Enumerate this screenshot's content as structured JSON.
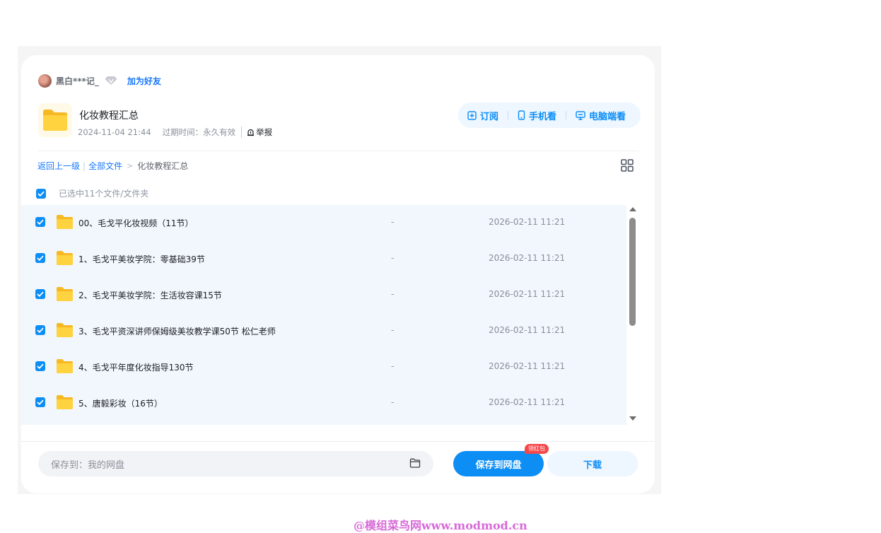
{
  "owner": {
    "username": "黑白***记_",
    "add_friend_label": "加为好友"
  },
  "share": {
    "title": "化妆教程汇总",
    "created": "2024-11-04 21:44",
    "expire_label": "过期时间：永久有效",
    "report_label": "举报"
  },
  "actions": {
    "subscribe": "订阅",
    "mobile": "手机看",
    "desktop": "电脑端看"
  },
  "breadcrumb": {
    "back": "返回上一级",
    "all_files": "全部文件",
    "current": "化妆教程汇总"
  },
  "selection": {
    "text": "已选中11个文件/文件夹"
  },
  "files": [
    {
      "name": "00、毛戈平化妆视频（11节）",
      "size": "-",
      "date": "2026-02-11 11:21"
    },
    {
      "name": "1、毛戈平美妆学院：零基础39节",
      "size": "-",
      "date": "2026-02-11 11:21"
    },
    {
      "name": "2、毛戈平美妆学院：生活妆容课15节",
      "size": "-",
      "date": "2026-02-11 11:21"
    },
    {
      "name": "3、毛戈平资深讲师保姆级美妆教学课50节 松仁老师",
      "size": "-",
      "date": "2026-02-11 11:21"
    },
    {
      "name": "4、毛戈平年度化妆指导130节",
      "size": "-",
      "date": "2026-02-11 11:21"
    },
    {
      "name": "5、唐毅彩妆（16节）",
      "size": "-",
      "date": "2026-02-11 11:21"
    }
  ],
  "footer": {
    "save_to": "保存到：我的网盘",
    "save_button": "保存到网盘",
    "badge": "领红包",
    "download_button": "下载"
  },
  "watermark": "@模组菜鸟网www.modmod.cn",
  "colors": {
    "accent": "#0d8ef5",
    "link": "#1677ff",
    "row_bg": "#f1f7fd",
    "badge": "#f5484a"
  }
}
